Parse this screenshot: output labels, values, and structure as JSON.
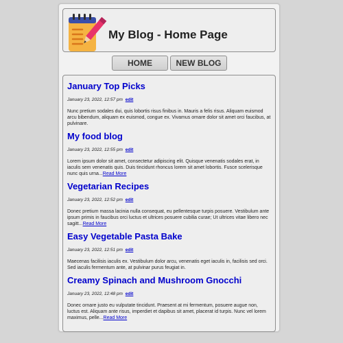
{
  "header": {
    "logo_icon": "notepad-pencil-icon",
    "title": "My Blog - Home Page"
  },
  "nav": {
    "home_label": "HOME",
    "new_blog_label": "NEW BLOG"
  },
  "posts": [
    {
      "title": "January Top Picks",
      "date": "January 23, 2022, 12:57 pm",
      "edit_label": "edit",
      "excerpt": "Nunc pretium sodales dui, quis lobortis risus finibus in. Mauris a felis risus. Aliquam euismod arcu bibendum, aliquam ex euismod, congue ex. Vivamus ornare dolor sit amet orci faucibus, at pulvinare.",
      "read_more": ""
    },
    {
      "title": "My food blog",
      "date": "January 23, 2022, 12:55 pm",
      "edit_label": "edit",
      "excerpt": "Lorem ipsum dolor sit amet, consectetur adipiscing elit. Quisque venenatis sodales erat, in iaculis sem venenatis quis. Duis tincidunt rhoncus lorem sit amet lobortis. Fusce scelerisque nunc quis urna...",
      "read_more": "Read More"
    },
    {
      "title": "Vegetarian Recipes",
      "date": "January 23, 2022, 12:52 pm",
      "edit_label": "edit",
      "excerpt": "Donec pretium massa lacinia nulla consequat, eu pellentesque turpis posuere. Vestibulum ante ipsum primis in faucibus orci luctus et ultrices posuere cubilia curae; Ut ultrices vitae libero nec sagitt...",
      "read_more": "Read More"
    },
    {
      "title": "Easy Vegetable Pasta Bake",
      "date": "January 23, 2022, 12:51 pm",
      "edit_label": "edit",
      "excerpt": "Maecenas facilisis iaculis ex. Vestibulum dolor arcu, venenatis eget iaculis in, facilisis sed orci. Sed iaculis fermentum ante, at pulvinar purus feugiat in.",
      "read_more": ""
    },
    {
      "title": "Creamy Spinach and Mushroom Gnocchi",
      "date": "January 23, 2022, 12:48 pm",
      "edit_label": "edit",
      "excerpt": "Donec ornare justo eu vulputate tincidunt. Praesent at mi fermentum, posuere augue non, luctus est. Aliquam ante risus, imperdiet et dapibus sit amet, placerat id turpis. Nunc vel lorem maximus, pelle...",
      "read_more": "Read More"
    }
  ]
}
